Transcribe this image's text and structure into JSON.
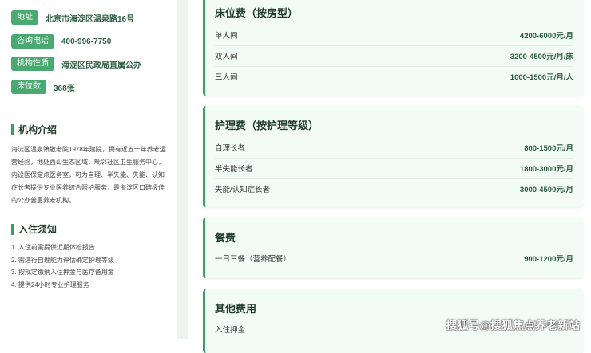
{
  "info": [
    {
      "tag": "地址",
      "value": "北京市海淀区温泉路16号"
    },
    {
      "tag": "咨询电话",
      "value": "400-996-7750"
    },
    {
      "tag": "机构性质",
      "value": "海淀区民政局直属公办"
    },
    {
      "tag": "床位数",
      "value": "368张"
    }
  ],
  "intro": {
    "title": "机构介绍",
    "text": "海淀区温泉镇敬老院1978年建院，拥有近五十年养老运营经验，地处西山生态区域，毗邻社区卫生服务中心，内设医保定点医务室，可为自理、半失能、失能、认知症长者提供专业医养结合照护服务，是海淀区口碑极佳的公办普惠养老机构。"
  },
  "notes": {
    "title": "入住须知",
    "items": [
      "1. 入住前需提供近期体检报告",
      "2. 需进行自理能力评估确定护理等级",
      "3. 按规定缴纳入住押金与医疗备用金",
      "4. 提供24小时专业护理服务"
    ]
  },
  "cards": [
    {
      "title": "床位费（按房型）",
      "rows": [
        {
          "name": "单人间",
          "price": "4200-6000元/月"
        },
        {
          "name": "双人间",
          "price": "3200-4500元/月/床"
        },
        {
          "name": "三人间",
          "price": "1000-1500元/月/人"
        }
      ]
    },
    {
      "title": "护理费（按护理等级）",
      "rows": [
        {
          "name": "自理长者",
          "price": "800-1500元/月"
        },
        {
          "name": "半失能长者",
          "price": "1800-3000元/月"
        },
        {
          "name": "失能/认知症长者",
          "price": "3000-4500元/月"
        }
      ]
    },
    {
      "title": "餐费",
      "rows": [
        {
          "name": "一日三餐（营养配餐）",
          "price": "900-1200元/月"
        }
      ]
    },
    {
      "title": "其他费用",
      "rows": [
        {
          "name": "入住押金",
          "price": ""
        }
      ]
    }
  ],
  "watermark": "搜狐号@搜狐焦点养老新站"
}
